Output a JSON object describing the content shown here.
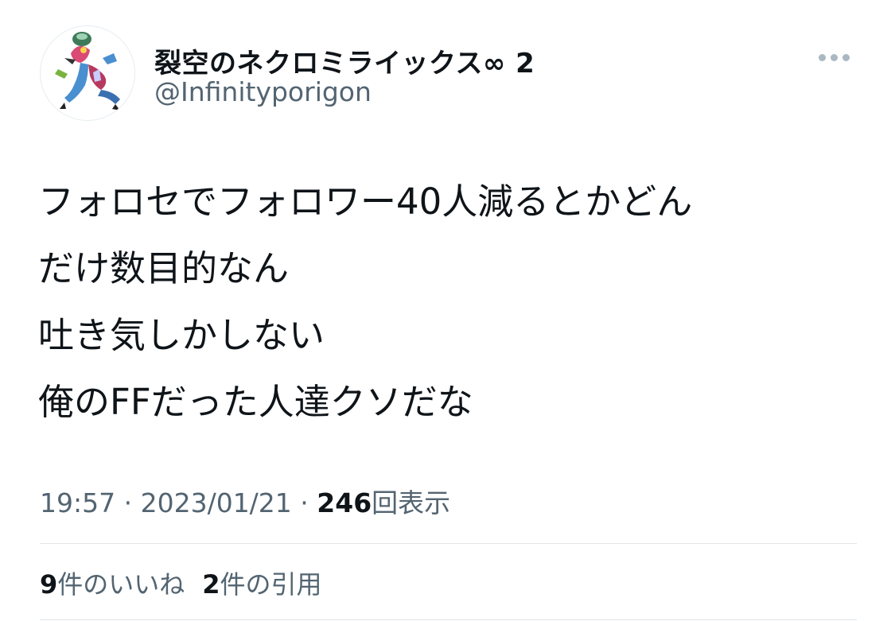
{
  "tweet": {
    "author": {
      "display_name": "裂空のネクロミライックス∞ 2",
      "handle": "@Infinityporigon",
      "avatar": "pokemon-avatar"
    },
    "more_icon": "more-horizontal-icon",
    "text_lines": [
      "フォロセでフォロワー40人減るとかどん",
      "だけ数目的なん",
      "吐き気しかしない",
      "俺のFFだった人達クソだな"
    ],
    "meta": {
      "time": "19:57",
      "separator": " · ",
      "date": "2023/01/21",
      "views_count": "246",
      "views_label": "回表示"
    },
    "stats": {
      "likes_count": "9",
      "likes_label": "件のいいね",
      "quotes_count": "2",
      "quotes_label": "件の引用"
    },
    "colors": {
      "text": "#0f1419",
      "secondary": "#536471",
      "divider": "#e1e6ea"
    }
  }
}
